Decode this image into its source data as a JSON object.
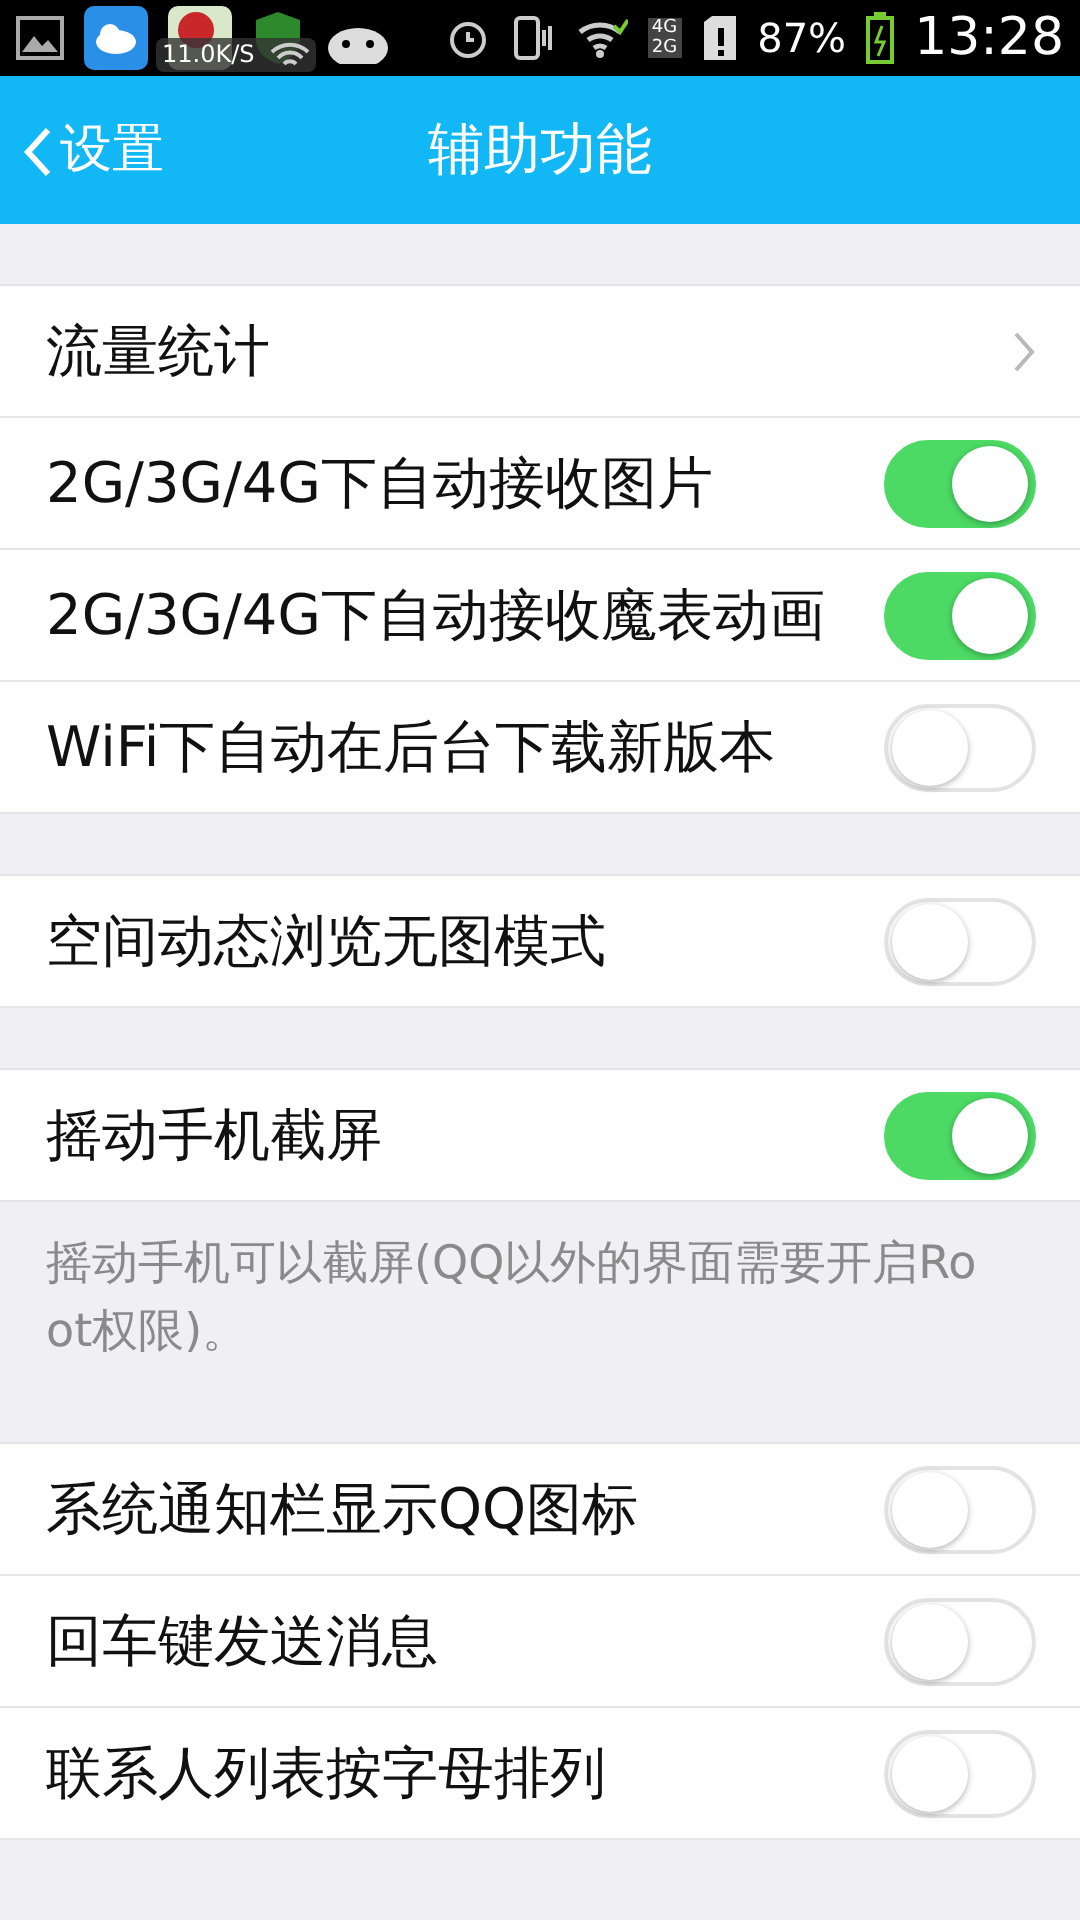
{
  "status_bar": {
    "speed": "11.0K/S",
    "network_top": "4G",
    "network_bottom": "2G",
    "battery": "87%",
    "time": "13:28"
  },
  "header": {
    "back": "设置",
    "title": "辅助功能"
  },
  "groups": [
    {
      "rows": [
        {
          "kind": "link",
          "label": "流量统计"
        },
        {
          "kind": "toggle",
          "label": "2G/3G/4G下自动接收图片",
          "on": true
        },
        {
          "kind": "toggle",
          "label": "2G/3G/4G下自动接收魔表动画",
          "on": true
        },
        {
          "kind": "toggle",
          "label": "WiFi下自动在后台下载新版本",
          "on": false
        }
      ]
    },
    {
      "rows": [
        {
          "kind": "toggle",
          "label": "空间动态浏览无图模式",
          "on": false
        }
      ]
    },
    {
      "rows": [
        {
          "kind": "toggle",
          "label": "摇动手机截屏",
          "on": true
        }
      ],
      "note": "摇动手机可以截屏(QQ以外的界面需要开启Root权限)。"
    },
    {
      "rows": [
        {
          "kind": "toggle",
          "label": "系统通知栏显示QQ图标",
          "on": false
        },
        {
          "kind": "toggle",
          "label": "回车键发送消息",
          "on": false
        },
        {
          "kind": "toggle",
          "label": "联系人列表按字母排列",
          "on": false
        }
      ]
    }
  ]
}
